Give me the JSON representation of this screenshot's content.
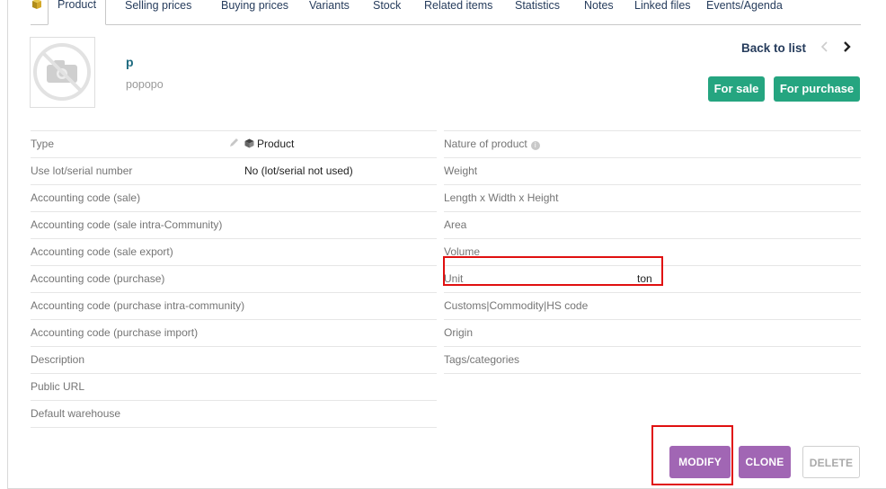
{
  "tabs": [
    {
      "label": "Product",
      "active": true
    },
    {
      "label": "Selling prices"
    },
    {
      "label": "Buying prices"
    },
    {
      "label": "Variants"
    },
    {
      "label": "Stock"
    },
    {
      "label": "Related items"
    },
    {
      "label": "Statistics"
    },
    {
      "label": "Notes"
    },
    {
      "label": "Linked files"
    },
    {
      "label": "Events/Agenda"
    }
  ],
  "header": {
    "ref": "p",
    "label": "popopo",
    "back_to_list": "Back to list",
    "badges": {
      "for_sale": "For sale",
      "for_purchase": "For purchase"
    },
    "badge_color": "#25a580"
  },
  "left_fields": [
    {
      "label": "Type",
      "value": "Product"
    },
    {
      "label": "Use lot/serial number",
      "value": "No (lot/serial not used)"
    },
    {
      "label": "Accounting code (sale)",
      "value": ""
    },
    {
      "label": "Accounting code (sale intra-Community)",
      "value": ""
    },
    {
      "label": "Accounting code (sale export)",
      "value": ""
    },
    {
      "label": "Accounting code (purchase)",
      "value": ""
    },
    {
      "label": "Accounting code (purchase intra-community)",
      "value": ""
    },
    {
      "label": "Accounting code (purchase import)",
      "value": ""
    },
    {
      "label": "Description",
      "value": ""
    },
    {
      "label": "Public URL",
      "value": ""
    },
    {
      "label": "Default warehouse",
      "value": ""
    }
  ],
  "right_fields": [
    {
      "label": "Nature of product",
      "value": ""
    },
    {
      "label": "Weight",
      "value": ""
    },
    {
      "label": "Length x Width x Height",
      "value": ""
    },
    {
      "label": "Area",
      "value": ""
    },
    {
      "label": "Volume",
      "value": ""
    },
    {
      "label": "Unit",
      "value": "ton"
    },
    {
      "label": "Customs|Commodity|HS code",
      "value": ""
    },
    {
      "label": "Origin",
      "value": ""
    },
    {
      "label": "Tags/categories",
      "value": ""
    }
  ],
  "actions": {
    "modify": "MODIFY",
    "clone": "CLONE",
    "delete": "DELETE"
  },
  "colors": {
    "action_purple": "#a166b4",
    "highlight": "#e01010",
    "tab_text": "#263c5c"
  }
}
